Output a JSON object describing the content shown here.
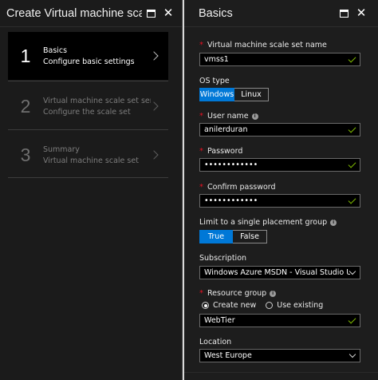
{
  "left_blade": {
    "title": "Create Virtual machine scale..",
    "steps": [
      {
        "number": "1",
        "title": "Basics",
        "subtitle": "Configure basic settings"
      },
      {
        "number": "2",
        "title": "Virtual machine scale set servic...",
        "subtitle": "Configure the scale set"
      },
      {
        "number": "3",
        "title": "Summary",
        "subtitle": "Virtual machine scale set"
      }
    ]
  },
  "right_blade": {
    "title": "Basics",
    "fields": {
      "vmss_name": {
        "label": "Virtual machine scale set name",
        "value": "vmss1"
      },
      "os_type": {
        "label": "OS type",
        "options": [
          "Windows",
          "Linux"
        ],
        "selected": "Windows"
      },
      "user_name": {
        "label": "User name",
        "value": "anilerduran"
      },
      "password": {
        "label": "Password",
        "value": "••••••••••••"
      },
      "confirm_password": {
        "label": "Confirm password",
        "value": "••••••••••••"
      },
      "placement_group": {
        "label": "Limit to a single placement group",
        "options": [
          "True",
          "False"
        ],
        "selected": "True"
      },
      "subscription": {
        "label": "Subscription",
        "value": "Windows Azure MSDN - Visual Studio Ultim"
      },
      "resource_group": {
        "label": "Resource group",
        "radio_create": "Create new",
        "radio_existing": "Use existing",
        "selected": "Create new",
        "value": "WebTier"
      },
      "location": {
        "label": "Location",
        "value": "West Europe"
      }
    }
  },
  "colors": {
    "accent": "#0078d7",
    "valid": "#7fba00",
    "required": "#e81123"
  },
  "icons": [
    "maximize-icon",
    "close-icon",
    "chevron-right-icon",
    "checkmark-icon",
    "info-icon",
    "chevron-down-icon"
  ]
}
